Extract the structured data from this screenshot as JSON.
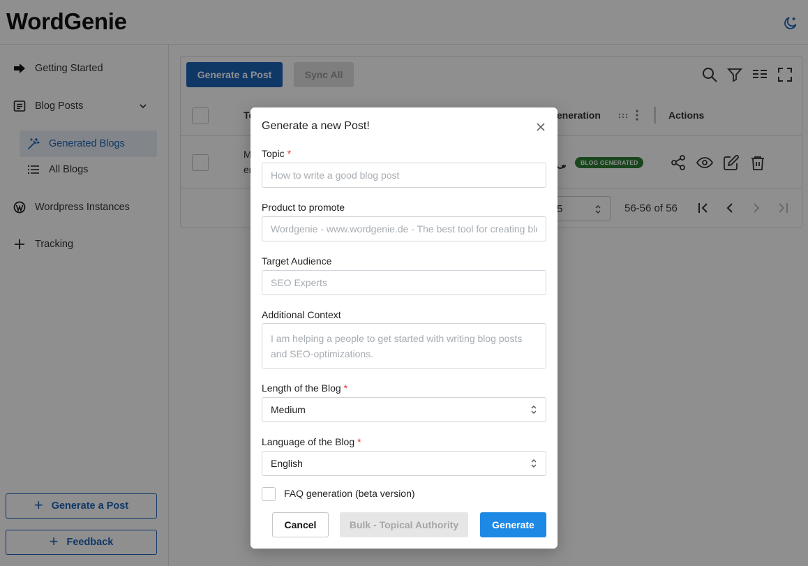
{
  "app": {
    "title": "WordGenie"
  },
  "sidebar": {
    "items": [
      {
        "label": "Getting Started"
      },
      {
        "label": "Blog Posts"
      },
      {
        "label": "Generated Blogs"
      },
      {
        "label": "All Blogs"
      },
      {
        "label": "Wordpress Instances"
      },
      {
        "label": "Tracking"
      }
    ],
    "generate_button": "Generate a Post",
    "feedback_button": "Feedback"
  },
  "toolbar": {
    "generate_label": "Generate a Post",
    "sync_label": "Sync All"
  },
  "table": {
    "columns": [
      "To",
      "Generation",
      "Actions"
    ],
    "row": {
      "topic_fragment_1": "M",
      "topic_fragment_2": "en",
      "status_badge": "BLOG GENERATED"
    },
    "rows_per_page_fragment": "5",
    "range": "56-56 of 56"
  },
  "modal": {
    "title": "Generate a new Post!",
    "fields": {
      "topic": {
        "label": "Topic",
        "required_mark": "*",
        "placeholder": "How to write a good blog post"
      },
      "product": {
        "label": "Product to promote",
        "placeholder": "Wordgenie - www.wordgenie.de - The best tool for creating blog posts"
      },
      "audience": {
        "label": "Target Audience",
        "placeholder": "SEO Experts"
      },
      "context": {
        "label": "Additional Context",
        "placeholder": "I am helping a people to get started with writing blog posts and SEO-optimizations."
      },
      "length": {
        "label": "Length of the Blog",
        "required_mark": "*",
        "value": "Medium"
      },
      "language": {
        "label": "Language of the Blog",
        "required_mark": "*",
        "value": "English"
      }
    },
    "faq_label": "FAQ generation (beta version)",
    "buttons": {
      "cancel": "Cancel",
      "bulk": "Bulk - Topical Authority",
      "generate": "Generate"
    }
  },
  "colors": {
    "primary": "#1d64b8",
    "generate_blue": "#1e88e5",
    "badge_green": "#2e7d32",
    "required_red": "#e03131"
  }
}
